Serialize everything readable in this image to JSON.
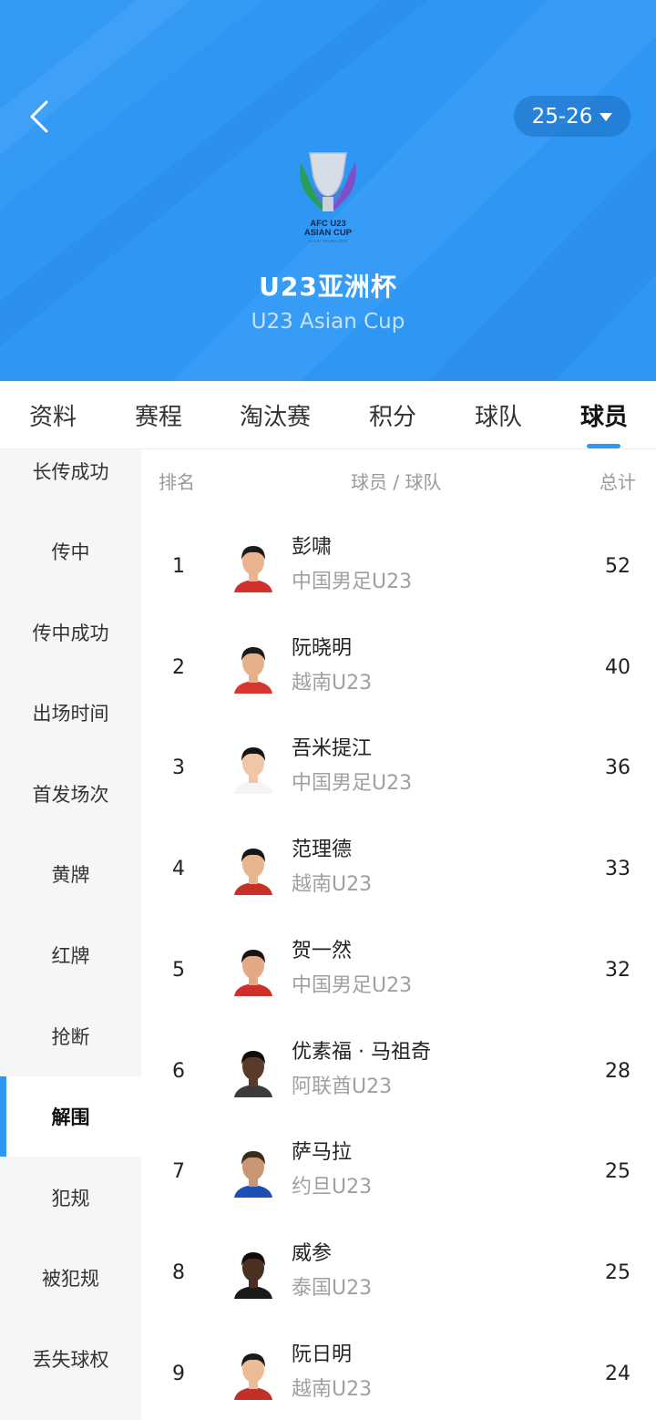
{
  "header": {
    "title_cn": "U23亚洲杯",
    "title_en": "U23 Asian Cup",
    "season": "25-26",
    "logo_icon": "afc-u23-asian-cup-trophy-logo",
    "logo_line1": "AFC U23",
    "logo_line2": "ASIAN CUP",
    "logo_line3": "SAUDI ARABIA 2026"
  },
  "colors": {
    "brand": "#2e96f3",
    "sidebar_bg": "#f5f6f8",
    "muted": "#a0a0a0"
  },
  "tabs": [
    {
      "label": "资料"
    },
    {
      "label": "赛程"
    },
    {
      "label": "淘汰赛"
    },
    {
      "label": "积分"
    },
    {
      "label": "球队"
    },
    {
      "label": "球员",
      "active": true
    }
  ],
  "sidebar": {
    "items": [
      {
        "label": "长传成功"
      },
      {
        "label": "传中"
      },
      {
        "label": "传中成功"
      },
      {
        "label": "出场时间"
      },
      {
        "label": "首发场次"
      },
      {
        "label": "黄牌"
      },
      {
        "label": "红牌"
      },
      {
        "label": "抢断"
      },
      {
        "label": "解围",
        "active": true
      },
      {
        "label": "犯规"
      },
      {
        "label": "被犯规"
      },
      {
        "label": "丢失球权"
      }
    ]
  },
  "table": {
    "headers": {
      "rank": "排名",
      "player_team": "球员 / 球队",
      "total": "总计"
    },
    "rows": [
      {
        "rank": "1",
        "name": "彭啸",
        "team": "中国男足U23",
        "total": "52"
      },
      {
        "rank": "2",
        "name": "阮晓明",
        "team": "越南U23",
        "total": "40"
      },
      {
        "rank": "3",
        "name": "吾米提江",
        "team": "中国男足U23",
        "total": "36"
      },
      {
        "rank": "4",
        "name": "范理德",
        "team": "越南U23",
        "total": "33"
      },
      {
        "rank": "5",
        "name": "贺一然",
        "team": "中国男足U23",
        "total": "32"
      },
      {
        "rank": "6",
        "name": "优素福 · 马祖奇",
        "team": "阿联酋U23",
        "total": "28"
      },
      {
        "rank": "7",
        "name": "萨马拉",
        "team": "约旦U23",
        "total": "25"
      },
      {
        "rank": "8",
        "name": "威参",
        "team": "泰国U23",
        "total": "25"
      },
      {
        "rank": "9",
        "name": "阮日明",
        "team": "越南U23",
        "total": "24"
      }
    ]
  }
}
